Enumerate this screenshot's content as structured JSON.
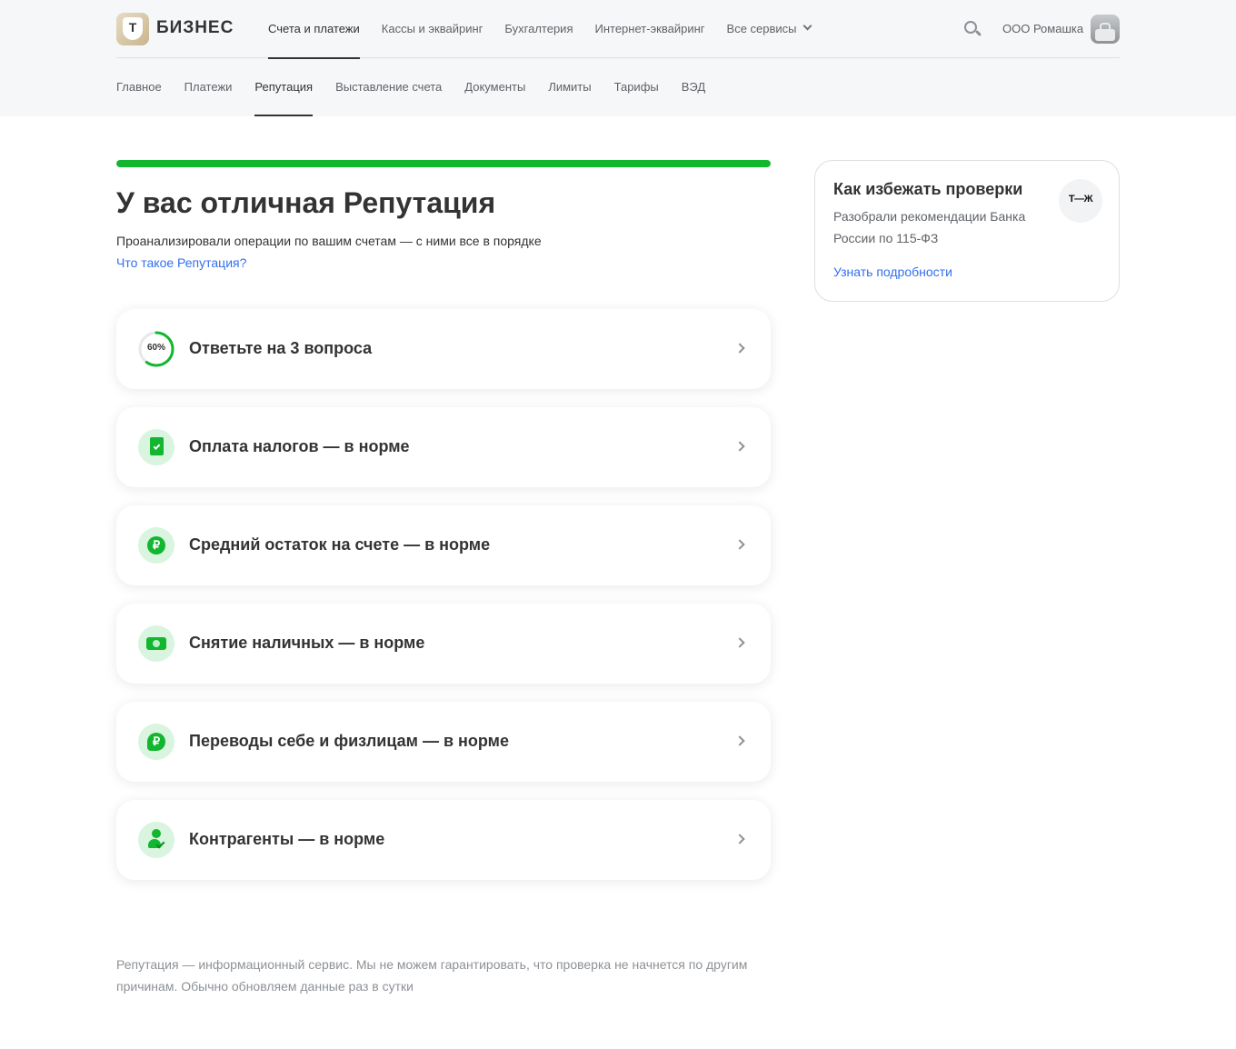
{
  "header": {
    "brand": "БИЗНЕС",
    "brand_letter": "Т",
    "top_nav": [
      {
        "label": "Счета и платежи",
        "active": true
      },
      {
        "label": "Кассы и эквайринг",
        "active": false
      },
      {
        "label": "Бухгалтерия",
        "active": false
      },
      {
        "label": "Интернет-эквайринг",
        "active": false
      },
      {
        "label": "Все сервисы",
        "active": false
      }
    ],
    "company_name": "ООО Ромашка"
  },
  "sub_nav": [
    {
      "label": "Главное",
      "active": false
    },
    {
      "label": "Платежи",
      "active": false
    },
    {
      "label": "Репутация",
      "active": true
    },
    {
      "label": "Выставление счета",
      "active": false
    },
    {
      "label": "Документы",
      "active": false
    },
    {
      "label": "Лимиты",
      "active": false
    },
    {
      "label": "Тарифы",
      "active": false
    },
    {
      "label": "ВЭД",
      "active": false
    }
  ],
  "main": {
    "reputation_level": 1.0,
    "title": "У вас отличная Репутация",
    "subtitle": "Проанализировали операции по вашим счетам — с ними все в порядке",
    "help_link": "Что такое Репутация?",
    "cards": [
      {
        "label": "Ответьте на 3 вопроса",
        "icon": "progress-ring-icon",
        "progress_text": "60%",
        "progress": 0.6
      },
      {
        "label": "Оплата налогов — в норме",
        "icon": "tax-document-icon"
      },
      {
        "label": "Средний остаток на счете — в норме",
        "icon": "ruble-coin-icon",
        "glyph": "₽"
      },
      {
        "label": "Снятие наличных — в норме",
        "icon": "cash-icon"
      },
      {
        "label": "Переводы себе и физлицам — в норме",
        "icon": "transfer-icon",
        "glyph": "₽"
      },
      {
        "label": "Контрагенты — в норме",
        "icon": "counterparty-icon"
      }
    ],
    "disclaimer": "Репутация — информационный сервис. Мы не можем гарантировать, что проверка не начнется по другим причинам. Обычно обновляем данные раз в сутки"
  },
  "side_card": {
    "title": "Как избежать проверки",
    "text": "Разобрали рекомендации Банка России по 115-ФЗ",
    "link": "Узнать подробности",
    "badge": "Т—Ж"
  },
  "colors": {
    "accent_green": "#12b62f",
    "link_blue": "#336fee",
    "header_bg": "#f6f7f8"
  }
}
